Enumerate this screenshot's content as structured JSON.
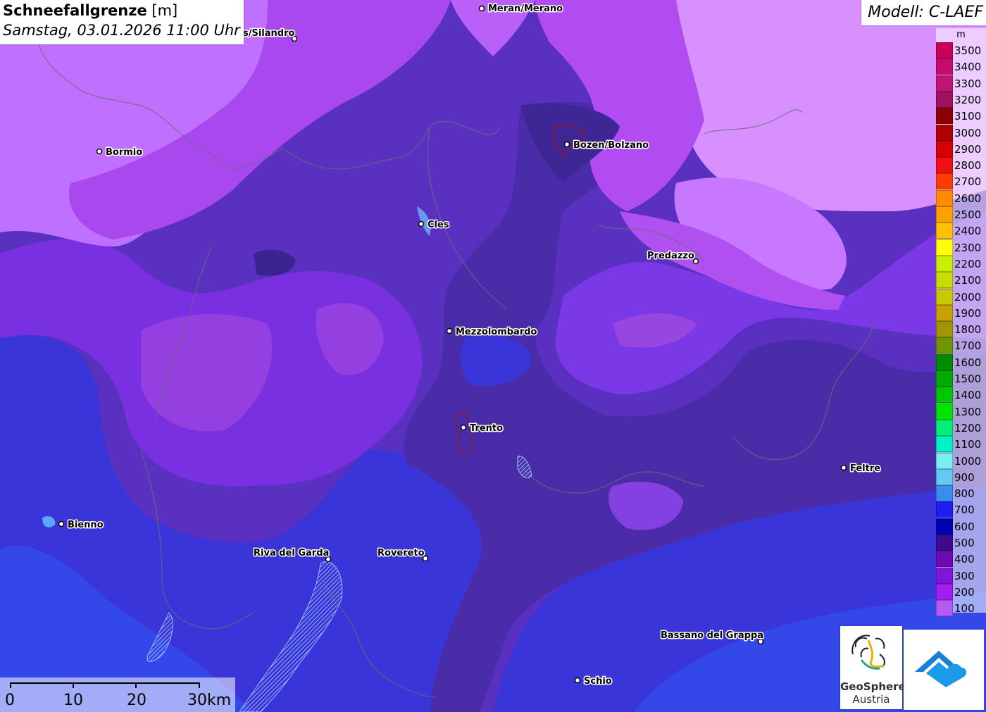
{
  "title": {
    "main": "Schneefallgrenze",
    "unit": "[m]",
    "datetime": "Samstag, 03.01.2026 11:00 Uhr"
  },
  "model": "Modell: C-LAEF",
  "legend": {
    "unit": "m",
    "entries": [
      {
        "label": "3500",
        "color": "#c8005a"
      },
      {
        "label": "3400",
        "color": "#c80a70"
      },
      {
        "label": "3300",
        "color": "#c01478"
      },
      {
        "label": "3200",
        "color": "#a01060"
      },
      {
        "label": "3100",
        "color": "#8a0000"
      },
      {
        "label": "3000",
        "color": "#b00000"
      },
      {
        "label": "2900",
        "color": "#d80000"
      },
      {
        "label": "2800",
        "color": "#f01010"
      },
      {
        "label": "2700",
        "color": "#ff3c00"
      },
      {
        "label": "2600",
        "color": "#ff8c00"
      },
      {
        "label": "2500",
        "color": "#ffa000"
      },
      {
        "label": "2400",
        "color": "#ffc000"
      },
      {
        "label": "2300",
        "color": "#ffff00"
      },
      {
        "label": "2200",
        "color": "#c8f000"
      },
      {
        "label": "2100",
        "color": "#c8dc00"
      },
      {
        "label": "2000",
        "color": "#c8c800"
      },
      {
        "label": "1900",
        "color": "#c8a000"
      },
      {
        "label": "1800",
        "color": "#a09600"
      },
      {
        "label": "1700",
        "color": "#6e9600"
      },
      {
        "label": "1600",
        "color": "#008c00"
      },
      {
        "label": "1500",
        "color": "#00aa00"
      },
      {
        "label": "1400",
        "color": "#00c800"
      },
      {
        "label": "1300",
        "color": "#00e600"
      },
      {
        "label": "1200",
        "color": "#00f078"
      },
      {
        "label": "1100",
        "color": "#00f0c8"
      },
      {
        "label": "1000",
        "color": "#78f0f0"
      },
      {
        "label": "900",
        "color": "#64c8f0"
      },
      {
        "label": "800",
        "color": "#3c8cf0"
      },
      {
        "label": "700",
        "color": "#1e1ef0"
      },
      {
        "label": "600",
        "color": "#0000b4"
      },
      {
        "label": "500",
        "color": "#3c0a8c"
      },
      {
        "label": "400",
        "color": "#6e0ab4"
      },
      {
        "label": "300",
        "color": "#8214dc"
      },
      {
        "label": "200",
        "color": "#a01ef0"
      },
      {
        "label": "100",
        "color": "#b45af5"
      }
    ]
  },
  "scale": {
    "labels": [
      "0",
      "10",
      "20",
      "30km"
    ]
  },
  "cities": [
    {
      "name": "Meran/Merano"
    },
    {
      "name": "s/Silandro"
    },
    {
      "name": "Bormio"
    },
    {
      "name": "Bozen/Bolzano"
    },
    {
      "name": "Cles"
    },
    {
      "name": "Predazzo"
    },
    {
      "name": "Mezzolombardo"
    },
    {
      "name": "Trento"
    },
    {
      "name": "Feltre"
    },
    {
      "name": "Bienno"
    },
    {
      "name": "Riva del Garda"
    },
    {
      "name": "Rovereto"
    },
    {
      "name": "Bassano del Grappa"
    },
    {
      "name": "Schio"
    }
  ],
  "logos": {
    "geosphere_line1": "GeoSphere",
    "geosphere_line2": "Austria"
  }
}
